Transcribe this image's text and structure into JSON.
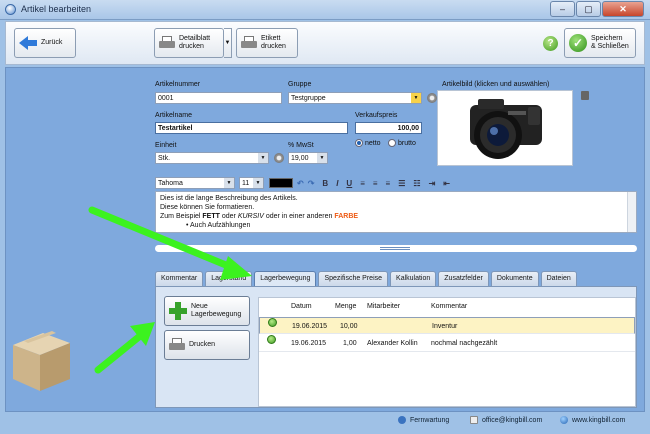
{
  "window": {
    "title": "Artikel bearbeiten",
    "buttons": [
      "–",
      "▢",
      "✕"
    ]
  },
  "toolbar": {
    "back_label": "Zurück",
    "print_detail_label": "Detailblatt\ndrucken",
    "print_label_label": "Etikett\ndrucken",
    "save_close_label": "Speichern\n& Schließen",
    "help_symbol": "?"
  },
  "form": {
    "article_number_label": "Artikelnummer",
    "article_number": "0001",
    "group_label": "Gruppe",
    "group": "Testgruppe",
    "image_label": "Artikelbild (klicken und auswählen)",
    "article_name_label": "Artikelname",
    "article_name": "Testartikel",
    "sale_price_label": "Verkaufspreis",
    "sale_price": "100,00",
    "unit_label": "Einheit",
    "unit": "Stk.",
    "vat_label": "% MwSt",
    "vat": "19,00",
    "price_mode_net": "netto",
    "price_mode_gross": "brutto",
    "price_mode_selected": "netto"
  },
  "editor": {
    "font": "Tahoma",
    "size": "11",
    "lines": {
      "l1": "Dies ist die lange Beschreibung des Artikels.",
      "l2": "Diese können Sie formatieren.",
      "l3_a": "Zum Beispiel ",
      "l3_bold": "FETT",
      "l3_b": " oder ",
      "l3_italic": "KURSIV",
      "l3_c": " oder in einer anderen ",
      "l3_color": "FARBE",
      "l4": "Auch Aufzählungen"
    },
    "accent_color": "#ee5a14"
  },
  "tabs": [
    {
      "label": "Kommentar"
    },
    {
      "label": "Lagerstand"
    },
    {
      "label": "Lagerbewegung"
    },
    {
      "label": "Spezifische Preise"
    },
    {
      "label": "Kalkulation"
    },
    {
      "label": "Zusatzfelder"
    },
    {
      "label": "Dokumente"
    },
    {
      "label": "Dateien"
    }
  ],
  "active_tab": "Lagerbewegung",
  "movement": {
    "new_label": "Neue\nLagerbewegung",
    "print_label": "Drucken",
    "columns": {
      "date": "Datum",
      "qty": "Menge",
      "employee": "Mitarbeiter",
      "comment": "Kommentar"
    },
    "rows": [
      {
        "date": "19.06.2015",
        "qty": "10,00",
        "employee": "",
        "comment": "Inventur",
        "status": "green"
      },
      {
        "date": "19.06.2015",
        "qty": "1,00",
        "employee": "Alexander Kollin",
        "comment": "nochmal nachgezählt",
        "status": "green"
      }
    ]
  },
  "footer": {
    "remote": "Fernwartung",
    "email": "office@kingbill.com",
    "web": "www.kingbill.com"
  },
  "colors": {
    "arrow": "#3cf21f",
    "selected_row": "#fdf3c4",
    "brand_blue": "#7fa9dd"
  }
}
